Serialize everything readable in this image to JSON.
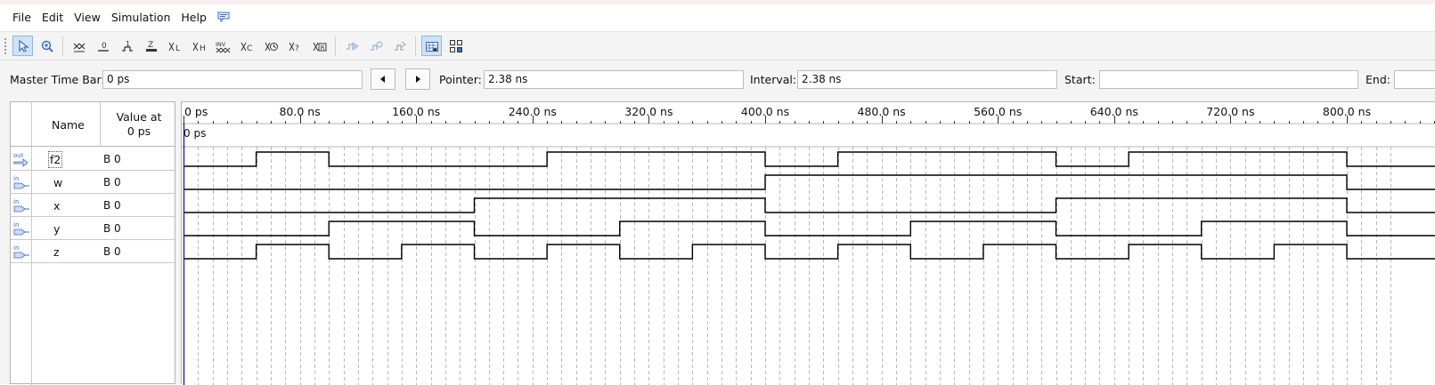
{
  "menu": {
    "file": "File",
    "edit": "Edit",
    "view": "View",
    "simulation": "Simulation",
    "help": "Help"
  },
  "toolbar": {
    "buttons": [
      {
        "name": "selection-tool-icon"
      },
      {
        "name": "zoom-tool-icon"
      },
      {
        "name": "forcing-unknown-icon"
      },
      {
        "name": "forcing-low-icon"
      },
      {
        "name": "forcing-high-icon"
      },
      {
        "name": "forcing-high-impedance-icon"
      },
      {
        "name": "weak-low-icon"
      },
      {
        "name": "weak-high-icon"
      },
      {
        "name": "invert-icon"
      },
      {
        "name": "count-value-icon"
      },
      {
        "name": "clock-icon"
      },
      {
        "name": "arbitrary-value-icon"
      },
      {
        "name": "random-value-icon"
      },
      {
        "name": "run-functional-simulation-icon"
      },
      {
        "name": "run-timing-simulation-icon"
      },
      {
        "name": "generate-netlist-icon"
      },
      {
        "name": "snap-to-grid-icon"
      },
      {
        "name": "grid-icon"
      }
    ]
  },
  "timebar": {
    "master_label": "Master Time Bar:",
    "master_value": "0 ps",
    "pointer_label": "Pointer:",
    "pointer_value": "2.38 ns",
    "interval_label": "Interval:",
    "interval_value": "2.38 ns",
    "start_label": "Start:",
    "start_value": "",
    "end_label": "End:"
  },
  "names_header": {
    "name": "Name",
    "value_line1": "Value at",
    "value_line2": "0 ps"
  },
  "signals": [
    {
      "type": "out",
      "name": "f2",
      "value": "B 0"
    },
    {
      "type": "in",
      "name": "w",
      "value": "B 0"
    },
    {
      "type": "in",
      "name": "x",
      "value": "B 0"
    },
    {
      "type": "in",
      "name": "y",
      "value": "B 0"
    },
    {
      "type": "in",
      "name": "z",
      "value": "B 0"
    }
  ],
  "timeline": {
    "ticks": [
      "0 ps",
      "80.0 ns",
      "160.0 ns",
      "240.0 ns",
      "320.0 ns",
      "400.0 ns",
      "480.0 ns",
      "560.0 ns",
      "640.0 ns",
      "720.0 ns",
      "800.0 ns"
    ],
    "master_marker_label": "0 ps",
    "time_unit": "ns",
    "grid_step_ns": 10,
    "visible_range_ns": [
      0,
      834
    ],
    "cursor_ns": 0,
    "colors": {
      "wave": "#000000",
      "grid": "#b8b8b8",
      "cursor": "#2a2ab8",
      "icon": "#3a6cc0"
    }
  },
  "waveforms": {
    "f2": [
      [
        0,
        0
      ],
      [
        50,
        1
      ],
      [
        100,
        0
      ],
      [
        250,
        1
      ],
      [
        400,
        0
      ],
      [
        450,
        1
      ],
      [
        600,
        0
      ],
      [
        650,
        1
      ],
      [
        800,
        0
      ]
    ],
    "w": [
      [
        0,
        0
      ],
      [
        400,
        1
      ],
      [
        800,
        0
      ]
    ],
    "x": [
      [
        0,
        0
      ],
      [
        200,
        1
      ],
      [
        400,
        0
      ],
      [
        600,
        1
      ],
      [
        800,
        0
      ]
    ],
    "y": [
      [
        0,
        0
      ],
      [
        100,
        1
      ],
      [
        200,
        0
      ],
      [
        300,
        1
      ],
      [
        400,
        0
      ],
      [
        500,
        1
      ],
      [
        600,
        0
      ],
      [
        700,
        1
      ],
      [
        800,
        0
      ]
    ],
    "z": [
      [
        0,
        0
      ],
      [
        50,
        1
      ],
      [
        100,
        0
      ],
      [
        150,
        1
      ],
      [
        200,
        0
      ],
      [
        250,
        1
      ],
      [
        300,
        0
      ],
      [
        350,
        1
      ],
      [
        400,
        0
      ],
      [
        450,
        1
      ],
      [
        500,
        0
      ],
      [
        550,
        1
      ],
      [
        600,
        0
      ],
      [
        650,
        1
      ],
      [
        700,
        0
      ],
      [
        750,
        1
      ],
      [
        800,
        0
      ]
    ]
  }
}
